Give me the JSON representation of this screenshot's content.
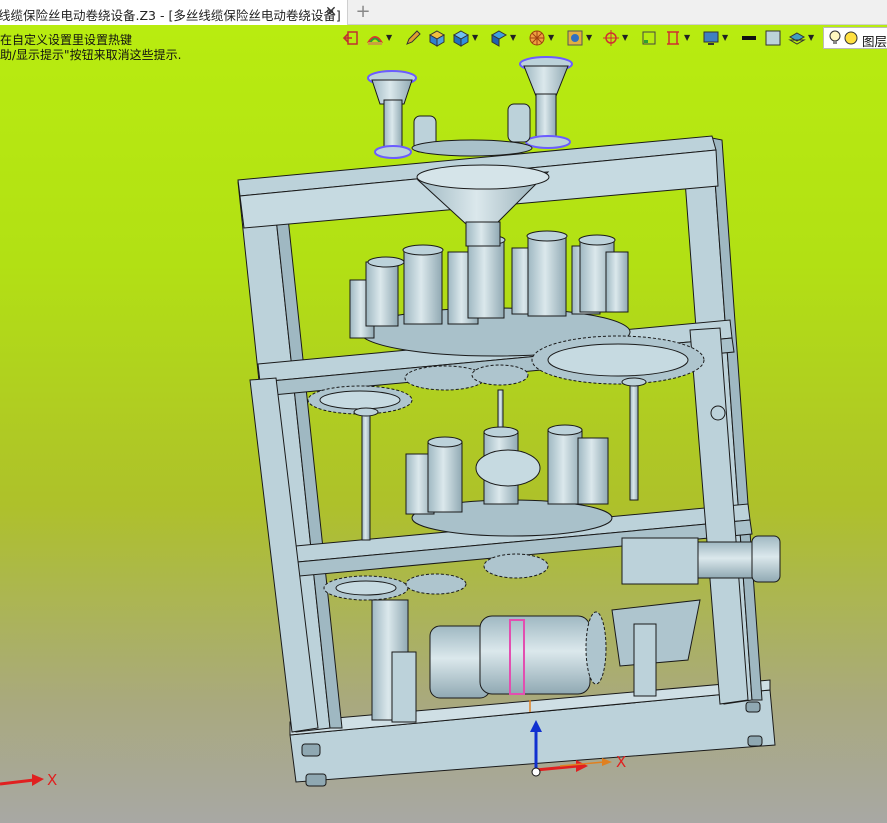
{
  "tab": {
    "title": "线缆保险丝电动卷绕设备.Z3 - [多丝线缆保险丝电动卷绕设备]",
    "close_glyph": "✕",
    "new_glyph": "+"
  },
  "hints": {
    "line1": "在自定义设置里设置热键",
    "line2": "助/显示提示\"按钮来取消这些提示."
  },
  "toolbar": {
    "layer_label": "图层",
    "icons": [
      "exit-icon",
      "rainbow-icon",
      "pencil-icon",
      "shaded-cube-icon",
      "solid-cube-icon",
      "view-orient-icon",
      "render-wheel-icon",
      "texture-icon",
      "crosshair-icon",
      "frame-icon",
      "section-icon",
      "display-icon",
      "line-weight-icon",
      "face-color-icon",
      "layer-stack-icon",
      "bulb-icon"
    ]
  },
  "axes": {
    "triad_x": "X",
    "corner_x": "X"
  },
  "colors": {
    "metal": "#bcd2da",
    "metal_dark": "#8fa8b2",
    "outline": "#1a1a1a",
    "accent_blue": "#6b5cff",
    "accent_pink": "#e24fb0",
    "axis_red": "#e02020",
    "axis_blue": "#1030d0",
    "axis_orange": "#e08020"
  }
}
